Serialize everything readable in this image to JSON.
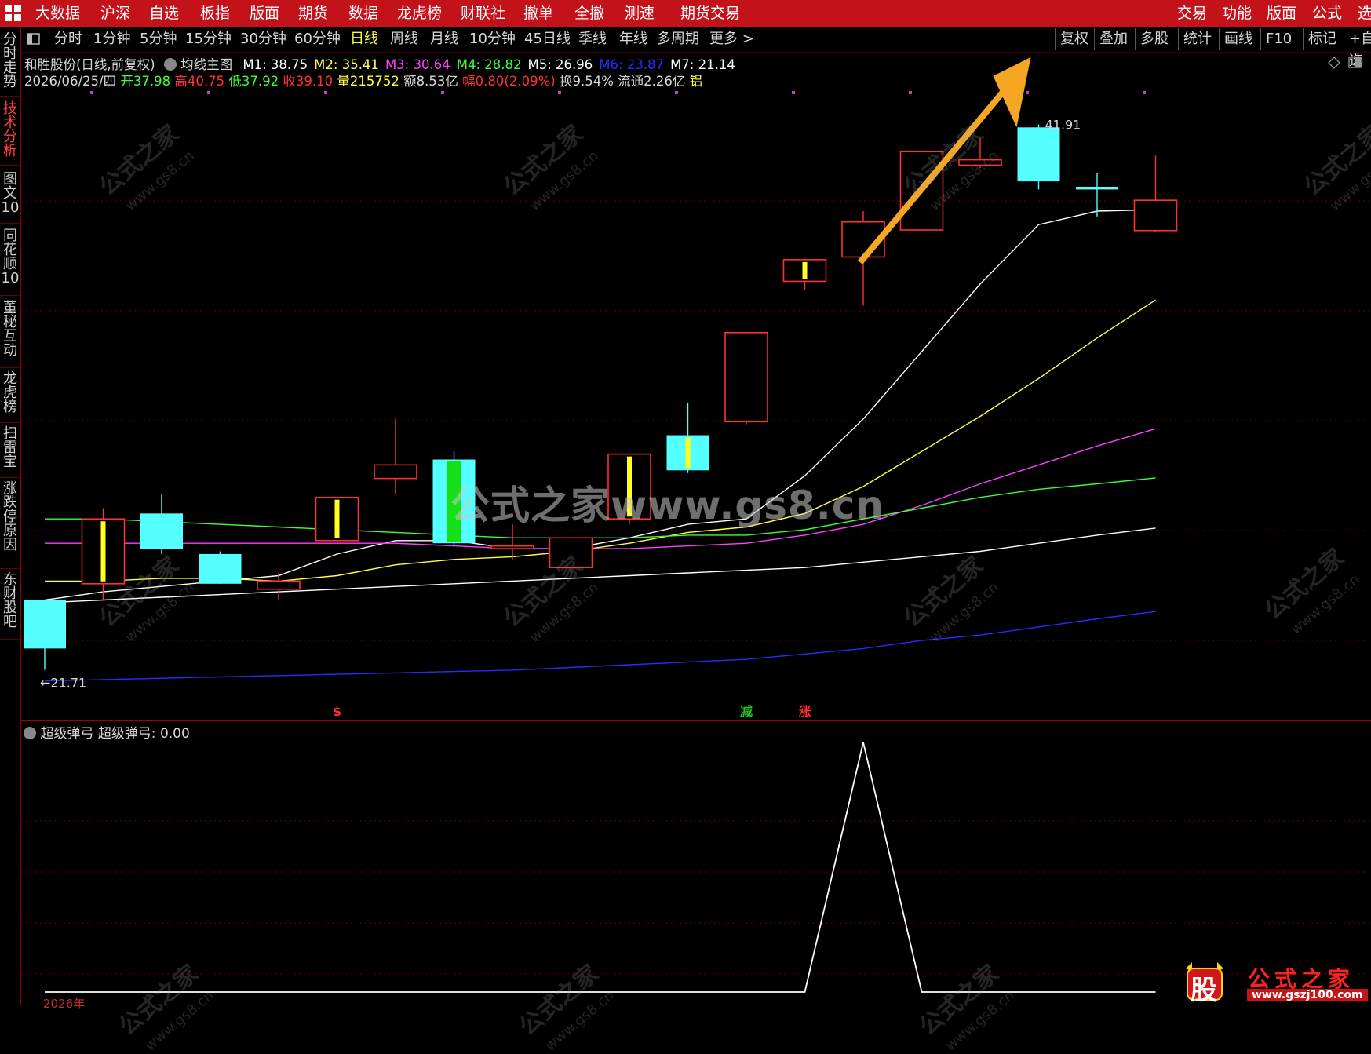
{
  "top_menu": [
    "大数据",
    "沪深",
    "自选",
    "板指",
    "版面",
    "期货",
    "数据",
    "龙虎榜",
    "财联社",
    "撤单",
    "全撤",
    "测速",
    "期货交易"
  ],
  "top_menu_right": [
    "交易",
    "功能",
    "版面",
    "公式",
    "选"
  ],
  "toolbar_periods": [
    "分时",
    "1分钟",
    "5分钟",
    "15分钟",
    "30分钟",
    "60分钟",
    "日线",
    "周线",
    "月线",
    "10分钟",
    "45日线",
    "季线",
    "年线",
    "多周期",
    "更多 >"
  ],
  "toolbar_active": "日线",
  "toolbar_right": [
    "复权",
    "叠加",
    "多股",
    "统计",
    "画线",
    "F10",
    "标记",
    "+自选"
  ],
  "side_tabs": [
    "分时走势",
    "技术分析",
    "图文10",
    "同花顺10",
    "董秘互动",
    "龙虎榜",
    "扫雷宝",
    "涨跌停原因",
    "东财股吧"
  ],
  "side_active": "技术分析",
  "header": {
    "stock": "和胜股份(日线,前复权)",
    "indicator": "均线主图",
    "ma": [
      {
        "label": "M1: 38.75",
        "color": "#ffffff"
      },
      {
        "label": "M2: 35.41",
        "color": "#ffff4a"
      },
      {
        "label": "M3: 30.64",
        "color": "#ff40ff"
      },
      {
        "label": "M4: 28.82",
        "color": "#3cff3c"
      },
      {
        "label": "M5: 26.96",
        "color": "#ffffff"
      },
      {
        "label": "M6: 23.87",
        "color": "#2a2aff"
      },
      {
        "label": "M7: 21.14",
        "color": "#ffffff"
      }
    ],
    "date": "2026/06/25/四",
    "open_label": "开",
    "open": "37.98",
    "high_label": "高",
    "high": "40.75",
    "low_label": "低",
    "low": "37.92",
    "close_label": "收",
    "close": "39.10",
    "vol_label": "量",
    "vol": "215752",
    "amount": "额8.53亿",
    "amp_label": "幅",
    "amp": "0.80(2.09%)",
    "turnover": "换9.54%",
    "float": "流通2.26亿",
    "sector": "铝"
  },
  "price_labels": {
    "high_marker": "41.91",
    "low_marker": "←21.71"
  },
  "signals": [
    {
      "text": "$",
      "color": "#ff3030"
    },
    {
      "text": "减",
      "color": "#1ec81e"
    },
    {
      "text": "涨",
      "color": "#ff3030"
    }
  ],
  "sub_header": {
    "name": "超级弹弓",
    "value_label": "超级弹弓: 0.00"
  },
  "bottom_text": "2026年",
  "watermark": "公式之家www.gs8.cn",
  "watermark_small": "公式之家",
  "watermark_url": "www.gs8.cn",
  "brand": {
    "logo_char": "股",
    "title": "公式之家",
    "url": "www.gszj100.com"
  },
  "colors": {
    "up": "#ff3232",
    "down": "#54ffff",
    "accent_red": "#c4121a",
    "arrow": "#f5a623"
  },
  "chart_data": {
    "type": "candlestick",
    "title": "",
    "candles": [
      {
        "o": 24.3,
        "h": 24.3,
        "l": 21.71,
        "c": 22.5
      },
      {
        "o": 24.9,
        "h": 27.7,
        "l": 24.3,
        "c": 27.3
      },
      {
        "o": 27.5,
        "h": 28.2,
        "l": 26.0,
        "c": 26.2
      },
      {
        "o": 26.0,
        "h": 26.1,
        "l": 24.9,
        "c": 24.9
      },
      {
        "o": 24.7,
        "h": 25.3,
        "l": 24.3,
        "c": 25.0
      },
      {
        "o": 26.5,
        "h": 28.1,
        "l": 26.5,
        "c": 28.1
      },
      {
        "o": 28.8,
        "h": 31.0,
        "l": 28.2,
        "c": 29.3
      },
      {
        "o": 29.5,
        "h": 29.8,
        "l": 26.3,
        "c": 26.4
      },
      {
        "o": 26.2,
        "h": 27.1,
        "l": 25.8,
        "c": 26.3
      },
      {
        "o": 25.5,
        "h": 26.6,
        "l": 25.3,
        "c": 26.6
      },
      {
        "o": 27.3,
        "h": 29.7,
        "l": 27.1,
        "c": 29.7
      },
      {
        "o": 30.4,
        "h": 31.6,
        "l": 29.0,
        "c": 29.1
      },
      {
        "o": 30.9,
        "h": 34.2,
        "l": 30.8,
        "c": 34.2
      },
      {
        "o": 36.1,
        "h": 36.9,
        "l": 35.8,
        "c": 36.9
      },
      {
        "o": 37.0,
        "h": 38.7,
        "l": 35.2,
        "c": 38.3
      },
      {
        "o": 38.0,
        "h": 40.9,
        "l": 38.1,
        "c": 40.9
      },
      {
        "o": 40.4,
        "h": 41.4,
        "l": 40.3,
        "c": 40.6
      },
      {
        "o": 41.8,
        "h": 41.91,
        "l": 39.5,
        "c": 39.8
      },
      {
        "o": 39.6,
        "h": 40.1,
        "l": 38.5,
        "c": 39.5
      },
      {
        "o": 37.98,
        "h": 40.75,
        "l": 37.92,
        "c": 39.1
      }
    ],
    "ma_series": [
      {
        "name": "M1",
        "color": "#ffffff",
        "values": [
          24.3,
          24.6,
          24.8,
          25.0,
          25.2,
          26.0,
          26.5,
          26.5,
          26.2,
          26.2,
          26.6,
          27.1,
          27.3,
          28.9,
          31.0,
          33.5,
          36.0,
          38.2,
          38.7,
          38.75
        ]
      },
      {
        "name": "M2",
        "color": "#ffff4a",
        "values": [
          25.0,
          25.0,
          25.1,
          25.1,
          25.0,
          25.2,
          25.6,
          25.8,
          25.9,
          26.1,
          26.4,
          26.8,
          27.0,
          27.5,
          28.5,
          29.8,
          31.1,
          32.5,
          34.0,
          35.41
        ]
      },
      {
        "name": "M3",
        "color": "#ff40ff",
        "values": [
          26.4,
          26.4,
          26.4,
          26.4,
          26.4,
          26.4,
          26.4,
          26.3,
          26.2,
          26.2,
          26.2,
          26.3,
          26.4,
          26.7,
          27.1,
          27.8,
          28.6,
          29.3,
          30.0,
          30.64
        ]
      },
      {
        "name": "M4",
        "color": "#3cff3c",
        "values": [
          27.3,
          27.3,
          27.2,
          27.1,
          27.0,
          26.9,
          26.8,
          26.7,
          26.6,
          26.6,
          26.6,
          26.7,
          26.7,
          26.9,
          27.3,
          27.7,
          28.1,
          28.4,
          28.6,
          28.82
        ]
      },
      {
        "name": "M5",
        "color": "#ffffff",
        "values": [
          24.2,
          24.3,
          24.4,
          24.5,
          24.6,
          24.7,
          24.8,
          24.9,
          25.0,
          25.1,
          25.2,
          25.3,
          25.4,
          25.5,
          25.7,
          25.9,
          26.1,
          26.4,
          26.7,
          26.96
        ]
      },
      {
        "name": "M6",
        "color": "#2a2aff",
        "values": [
          21.3,
          21.35,
          21.4,
          21.45,
          21.5,
          21.55,
          21.6,
          21.65,
          21.7,
          21.8,
          21.9,
          22.0,
          22.1,
          22.3,
          22.5,
          22.8,
          23.0,
          23.3,
          23.6,
          23.87
        ]
      }
    ],
    "sub_series": {
      "name": "超级弹弓",
      "values": [
        0,
        0,
        0,
        0,
        0,
        0,
        0,
        0,
        0,
        0,
        0,
        0,
        0,
        0,
        1,
        0,
        0,
        0,
        0,
        0
      ]
    },
    "ylim": [
      21.0,
      43.0
    ]
  }
}
